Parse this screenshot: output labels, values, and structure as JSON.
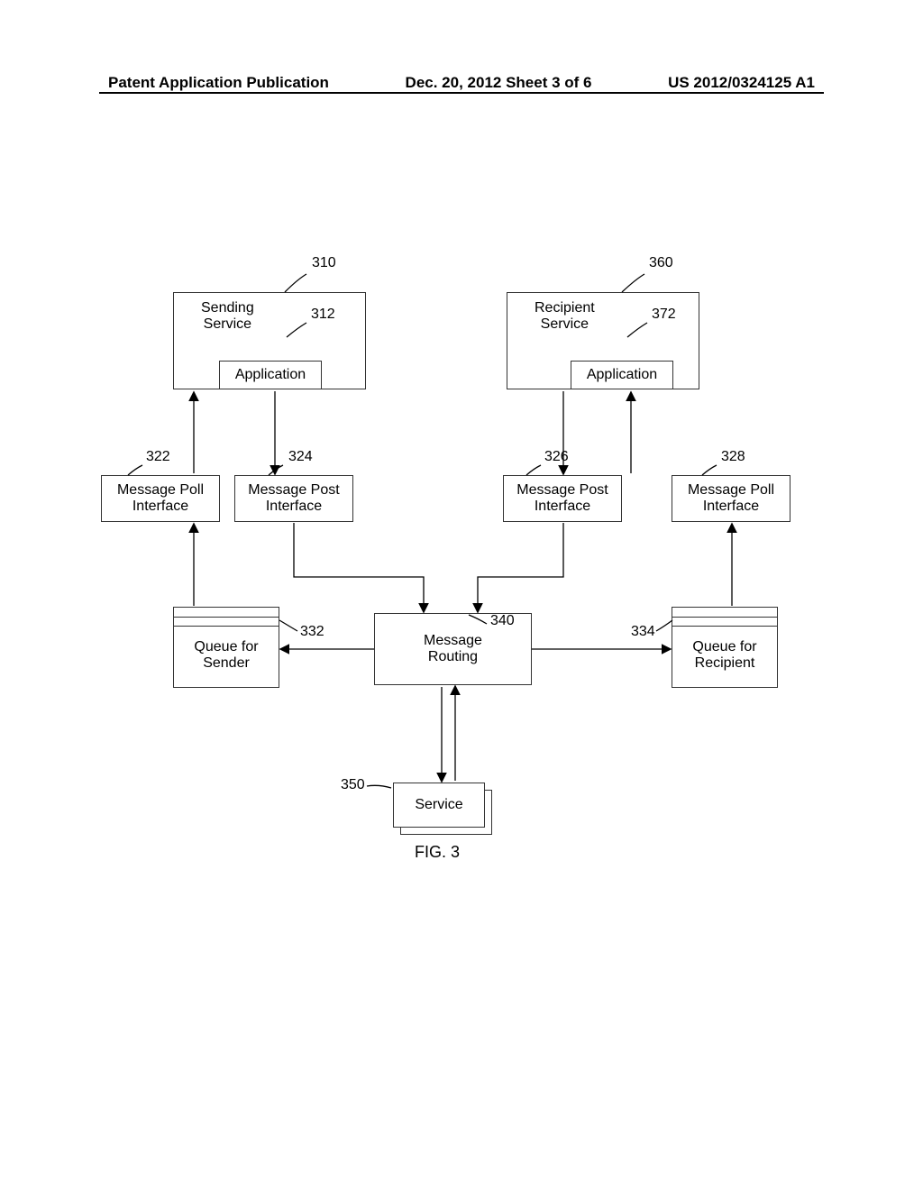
{
  "header": {
    "left": "Patent Application Publication",
    "center": "Dec. 20, 2012  Sheet 3 of 6",
    "right": "US 2012/0324125 A1"
  },
  "boxes": {
    "sendingService": {
      "title1": "Sending",
      "title2": "Service",
      "ref": "310",
      "appRef": "312",
      "app": "Application"
    },
    "recipientService": {
      "title1": "Recipient",
      "title2": "Service",
      "ref": "360",
      "appRef": "372",
      "app": "Application"
    },
    "if322": {
      "line1": "Message Poll",
      "line2": "Interface",
      "ref": "322"
    },
    "if324": {
      "line1": "Message Post",
      "line2": "Interface",
      "ref": "324"
    },
    "if326": {
      "line1": "Message Post",
      "line2": "Interface",
      "ref": "326"
    },
    "if328": {
      "line1": "Message Poll",
      "line2": "Interface",
      "ref": "328"
    },
    "queueSender": {
      "line1": "Queue for",
      "line2": "Sender",
      "ref": "332"
    },
    "queueRecipient": {
      "line1": "Queue for",
      "line2": "Recipient",
      "ref": "334"
    },
    "routing": {
      "line1": "Message",
      "line2": "Routing",
      "ref": "340"
    },
    "service": {
      "label": "Service",
      "ref": "350"
    }
  },
  "figureLabel": "FIG. 3"
}
